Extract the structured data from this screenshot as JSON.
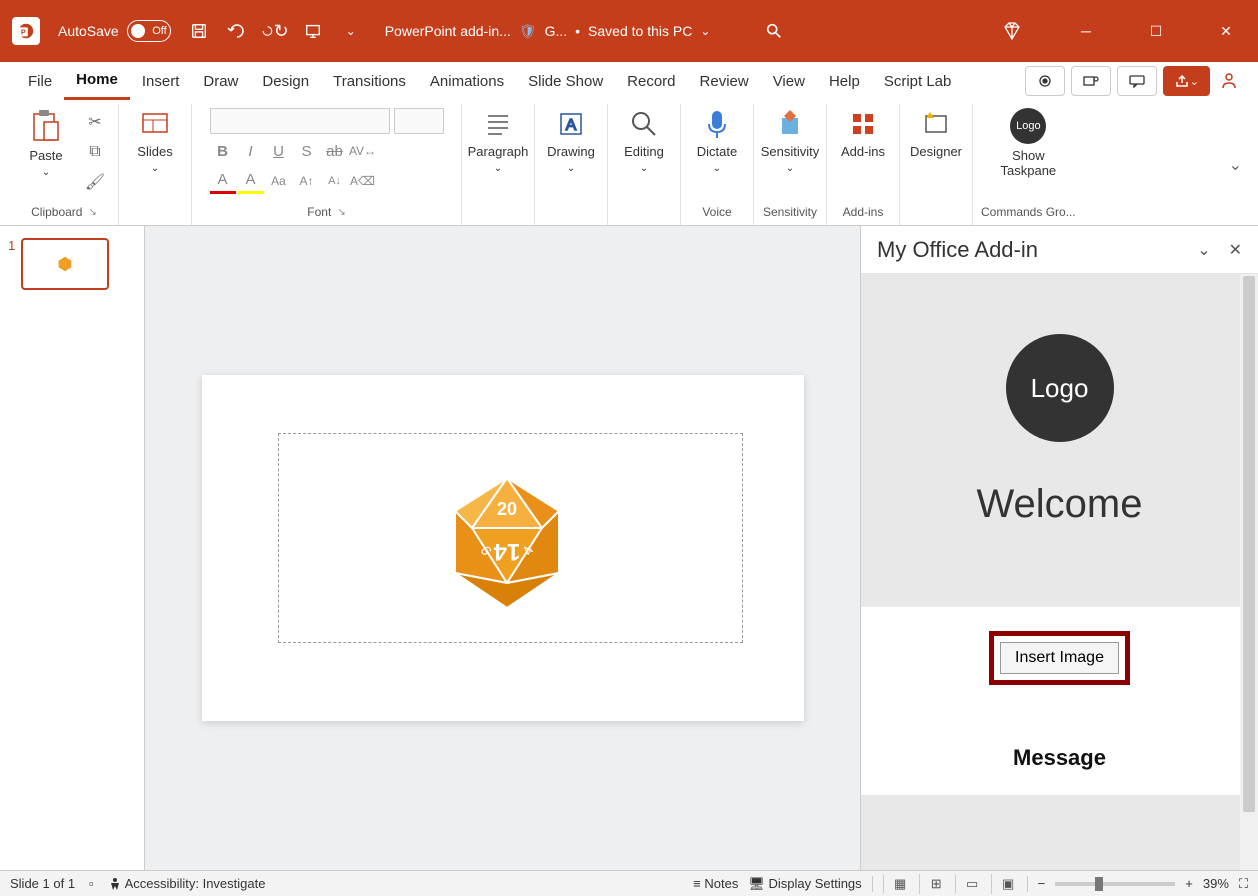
{
  "titlebar": {
    "autosave_label": "AutoSave",
    "autosave_state": "Off",
    "doc_name": "PowerPoint add-in...",
    "sensitivity_label": "G...",
    "save_status": "Saved to this PC"
  },
  "tabs": [
    "File",
    "Home",
    "Insert",
    "Draw",
    "Design",
    "Transitions",
    "Animations",
    "Slide Show",
    "Record",
    "Review",
    "View",
    "Help",
    "Script Lab"
  ],
  "active_tab": "Home",
  "ribbon": {
    "clipboard": {
      "paste": "Paste",
      "label": "Clipboard"
    },
    "slides": {
      "btn": "Slides",
      "label": ""
    },
    "font": {
      "label": "Font"
    },
    "paragraph": {
      "btn": "Paragraph",
      "label": ""
    },
    "drawing": {
      "btn": "Drawing",
      "label": ""
    },
    "editing": {
      "btn": "Editing",
      "label": ""
    },
    "dictate": {
      "btn": "Dictate",
      "label": "Voice"
    },
    "sensitivity": {
      "btn": "Sensitivity",
      "label": "Sensitivity"
    },
    "addins": {
      "btn": "Add-ins",
      "label": "Add-ins"
    },
    "designer": {
      "btn": "Designer",
      "label": ""
    },
    "taskpane_btn": {
      "line1": "Show",
      "line2": "Taskpane",
      "label": "Commands Gro..."
    }
  },
  "slides_panel": {
    "items": [
      {
        "num": "1"
      }
    ]
  },
  "taskpane": {
    "title": "My Office Add-in",
    "logo_text": "Logo",
    "welcome": "Welcome",
    "button": "Insert Image",
    "message_label": "Message"
  },
  "statusbar": {
    "slide_info": "Slide 1 of 1",
    "accessibility": "Accessibility: Investigate",
    "notes": "Notes",
    "display": "Display Settings",
    "zoom": "39%"
  }
}
